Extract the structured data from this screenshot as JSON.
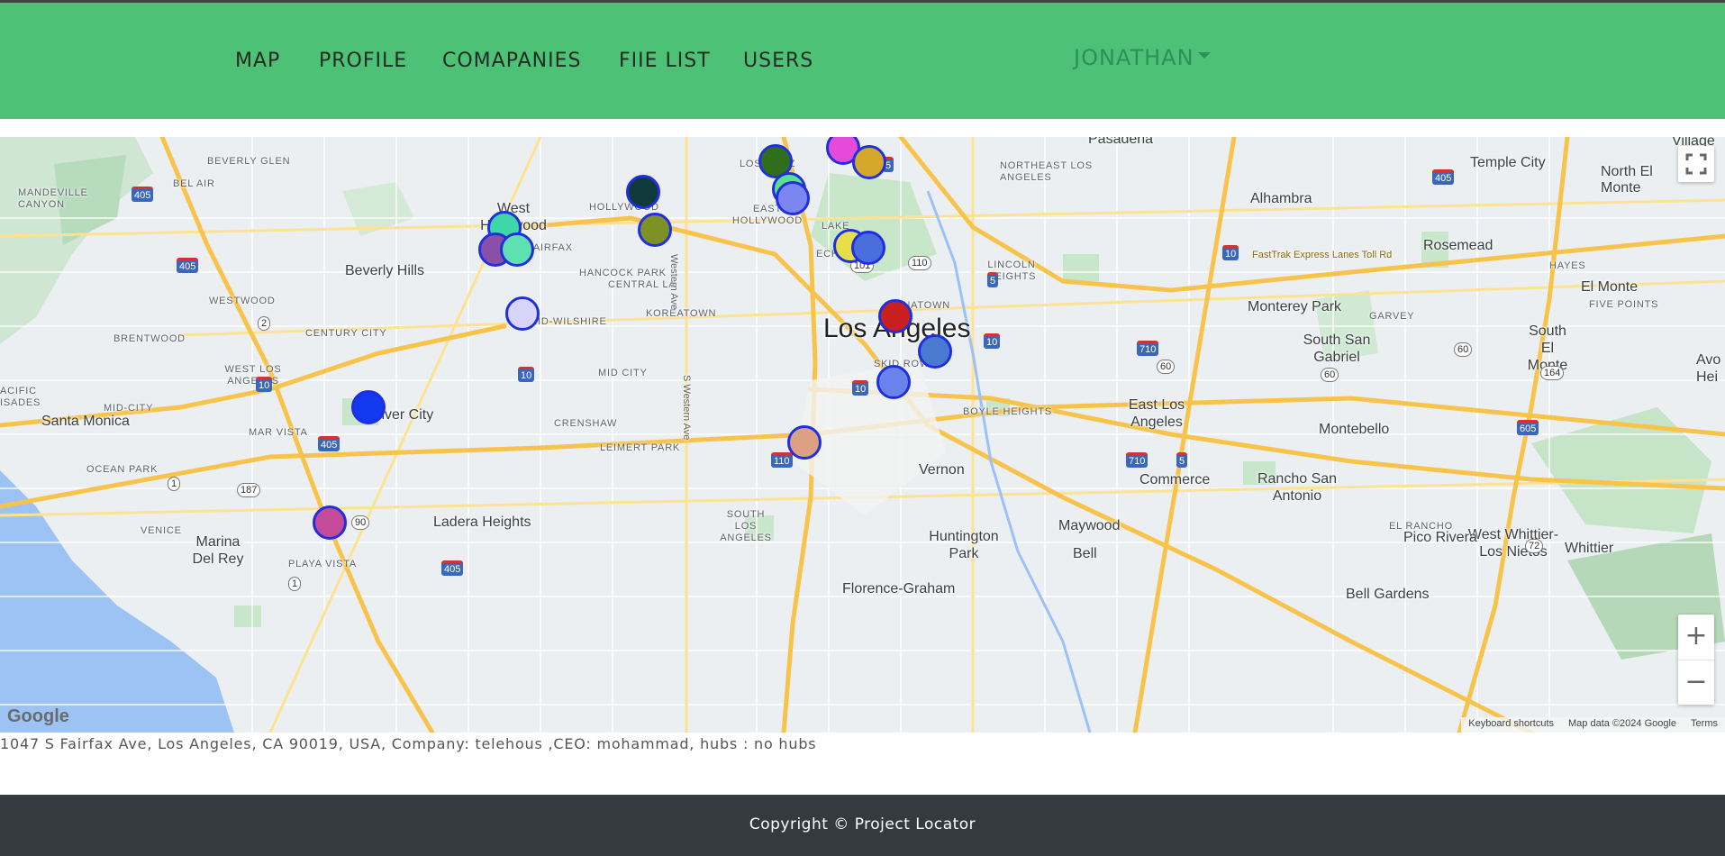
{
  "nav": {
    "links": [
      "MAP",
      "PROFILE",
      "COMAPANIES",
      "FIIE LIST",
      "USERS"
    ],
    "user": "JONATHAN"
  },
  "map": {
    "places": [
      {
        "name": "Pasadena",
        "size": "mid"
      },
      {
        "name": "Village",
        "size": "mid"
      },
      {
        "name": "Temple City",
        "size": "mid"
      },
      {
        "name": "North El Monte",
        "size": "mid"
      },
      {
        "name": "BEVERLY GLEN",
        "size": "small"
      },
      {
        "name": "LOS FELIZ",
        "size": "small"
      },
      {
        "name": "NORTHEAST LOS ANGELES",
        "size": "small"
      },
      {
        "name": "Alhambra",
        "size": "mid"
      },
      {
        "name": "MANDEVILLE CANYON",
        "size": "small"
      },
      {
        "name": "BEL AIR",
        "size": "small"
      },
      {
        "name": "West Hollywood",
        "size": "mid"
      },
      {
        "name": "HOLLYWOOD",
        "size": "small"
      },
      {
        "name": "EAST HOLLYWOOD",
        "size": "small"
      },
      {
        "name": "LAKE",
        "size": "small"
      },
      {
        "name": "Rosemead",
        "size": "mid"
      },
      {
        "name": "FAIRFAX",
        "size": "small"
      },
      {
        "name": "ECHO PARK",
        "size": "small"
      },
      {
        "name": "LINCOLN HEIGHTS",
        "size": "small"
      },
      {
        "name": "HAYES",
        "size": "small"
      },
      {
        "name": "Beverly Hills",
        "size": "mid"
      },
      {
        "name": "HANCOCK PARK",
        "size": "small"
      },
      {
        "name": "CENTRAL LA",
        "size": "small"
      },
      {
        "name": "El Monte",
        "size": "mid"
      },
      {
        "name": "WESTWOOD",
        "size": "small"
      },
      {
        "name": "KOREATOWN",
        "size": "small"
      },
      {
        "name": "CHINATOWN",
        "size": "small"
      },
      {
        "name": "Monterey Park",
        "size": "mid"
      },
      {
        "name": "GARVEY",
        "size": "small"
      },
      {
        "name": "FIVE POINTS",
        "size": "small"
      },
      {
        "name": "MID-WILSHIRE",
        "size": "small"
      },
      {
        "name": "BRENTWOOD",
        "size": "small"
      },
      {
        "name": "CENTURY CITY",
        "size": "small"
      },
      {
        "name": "Los Angeles",
        "size": "big"
      },
      {
        "name": "South San Gabriel",
        "size": "mid"
      },
      {
        "name": "South El Monte",
        "size": "mid"
      },
      {
        "name": "WEST LOS ANGELES",
        "size": "small"
      },
      {
        "name": "MID CITY",
        "size": "small"
      },
      {
        "name": "SKID ROW",
        "size": "small"
      },
      {
        "name": "ACIFIC ISADES",
        "size": "small"
      },
      {
        "name": "MID-CITY",
        "size": "small"
      },
      {
        "name": "BOYLE HEIGHTS",
        "size": "small"
      },
      {
        "name": "Avo Hei",
        "size": "mid"
      },
      {
        "name": "East Los Angeles",
        "size": "mid"
      },
      {
        "name": "Santa Monica",
        "size": "mid"
      },
      {
        "name": "Culver City",
        "size": "mid"
      },
      {
        "name": "CRENSHAW",
        "size": "small"
      },
      {
        "name": "Montebello",
        "size": "mid"
      },
      {
        "name": "MAR VISTA",
        "size": "small"
      },
      {
        "name": "LEIMERT PARK",
        "size": "small"
      },
      {
        "name": "OCEAN PARK",
        "size": "small"
      },
      {
        "name": "Vernon",
        "size": "mid"
      },
      {
        "name": "Commerce",
        "size": "mid"
      },
      {
        "name": "Rancho San Antonio",
        "size": "mid"
      },
      {
        "name": "SOUTH LOS ANGELES",
        "size": "small"
      },
      {
        "name": "EL RANCHO",
        "size": "small"
      },
      {
        "name": "Ladera Heights",
        "size": "mid"
      },
      {
        "name": "Maywood",
        "size": "mid"
      },
      {
        "name": "VENICE",
        "size": "small"
      },
      {
        "name": "Huntington Park",
        "size": "mid"
      },
      {
        "name": "West Whittier-Los Nietos",
        "size": "mid"
      },
      {
        "name": "Pico Rivera",
        "size": "mid"
      },
      {
        "name": "Whittier",
        "size": "mid"
      },
      {
        "name": "Marina Del Rey",
        "size": "mid"
      },
      {
        "name": "Bell",
        "size": "mid"
      },
      {
        "name": "PLAYA VISTA",
        "size": "small"
      },
      {
        "name": "Florence-Graham",
        "size": "mid"
      },
      {
        "name": "Bell Gardens",
        "size": "mid"
      }
    ],
    "road_labels": [
      "Western Ave",
      "S Western Ave",
      "FastTrak Express Lanes Toll Rd"
    ],
    "shields": [
      "405",
      "405",
      "405",
      "405",
      "405",
      "101",
      "110",
      "110",
      "2",
      "5",
      "5",
      "5",
      "10",
      "10",
      "10",
      "10",
      "10",
      "710",
      "710",
      "60",
      "60",
      "60",
      "164",
      "605",
      "1",
      "1",
      "187",
      "90",
      "72"
    ],
    "markers": [
      {
        "color": "#e64ad9"
      },
      {
        "color": "#2f6f1c"
      },
      {
        "color": "#d4a82a"
      },
      {
        "color": "#103a3a"
      },
      {
        "color": "#5de08a"
      },
      {
        "color": "#7b86f0"
      },
      {
        "color": "#3fd6a8"
      },
      {
        "color": "#7e9124"
      },
      {
        "color": "#8a4fa8"
      },
      {
        "color": "#5ee0b0"
      },
      {
        "color": "#e8de4a"
      },
      {
        "color": "#4a6fdc"
      },
      {
        "color": "#d8d4fa"
      },
      {
        "color": "#c8201e"
      },
      {
        "color": "#4a7ad0"
      },
      {
        "color": "#6a82ec"
      },
      {
        "color": "#1238f0"
      },
      {
        "color": "#dca082"
      },
      {
        "color": "#c44a9a"
      }
    ],
    "controls": {
      "zoom_in": "+",
      "zoom_out": "−"
    },
    "logo": "Google",
    "attribution": [
      "Keyboard shortcuts",
      "Map data ©2024 Google",
      "Terms"
    ]
  },
  "info_text": "1047 S Fairfax Ave, Los Angeles, CA 90019, USA, Company: telehous ,CEO: mohammad, hubs : no hubs",
  "footer": {
    "copyright": "Copyright © Project Locator"
  }
}
